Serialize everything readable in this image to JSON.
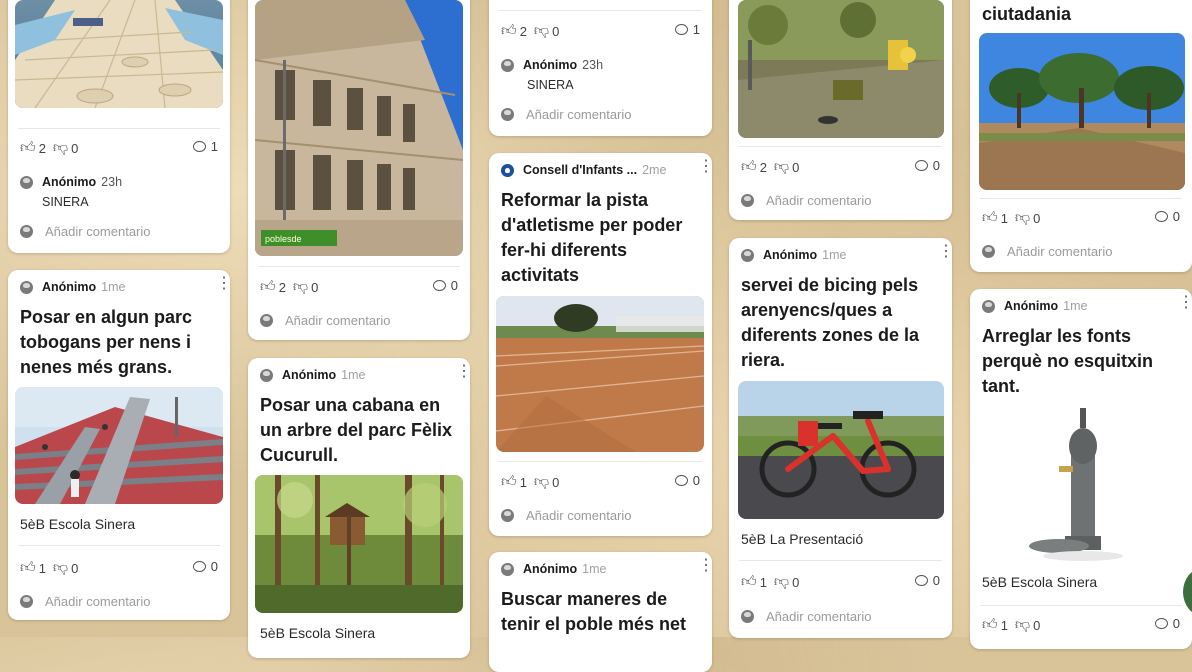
{
  "colors": {
    "board_bg": "#d9c49a",
    "card_bg": "#ffffff",
    "muted": "#9b9b9b"
  },
  "icons": {
    "like": "thumbs-up-icon",
    "dislike": "thumbs-down-icon",
    "comment": "comment-icon",
    "menu": "more-vertical-icon"
  },
  "add_comment": "Añadir comentario",
  "cards": {
    "c1a": {
      "likes": "2",
      "dislikes": "0",
      "comments": "1",
      "author": "Anónimo",
      "time": "23h",
      "comment_text": "SINERA"
    },
    "c1b": {
      "author": "Anónimo",
      "time": "1me",
      "title_lines": [
        "Posar en algun parc",
        "tobogans per nens i",
        "nenes més grans."
      ],
      "caption": "5èB Escola Sinera",
      "likes": "1",
      "dislikes": "0",
      "comments": "0"
    },
    "c2a": {
      "watermark": "poblesde",
      "likes": "2",
      "dislikes": "0",
      "comments": "0"
    },
    "c2b": {
      "author": "Anónimo",
      "time": "1me",
      "title_lines": [
        "Posar una cabana en",
        "un arbre del parc Fèlix",
        "Cucurull."
      ],
      "caption": "5èB Escola Sinera"
    },
    "c3a": {
      "likes": "2",
      "dislikes": "0",
      "comments": "1",
      "author": "Anónimo",
      "time": "23h",
      "comment_text": "SINERA"
    },
    "c3b": {
      "author": "Consell d'Infants ...",
      "time": "2me",
      "title_lines": [
        "Reformar la pista",
        "d'atletisme per poder",
        "fer-hi diferents",
        "activitats"
      ],
      "likes": "1",
      "dislikes": "0",
      "comments": "0"
    },
    "c3c": {
      "author": "Anónimo",
      "time": "1me",
      "title_lines": [
        "Buscar maneres de",
        "tenir el poble més net"
      ]
    },
    "c4a": {
      "likes": "2",
      "dislikes": "0",
      "comments": "0"
    },
    "c4b": {
      "author": "Anónimo",
      "time": "1me",
      "title_lines": [
        "servei de bicing pels",
        "arenyencs/ques a",
        "diferents zones de la",
        "riera."
      ],
      "caption": "5èB La Presentació",
      "likes": "1",
      "dislikes": "0",
      "comments": "0"
    },
    "c5a": {
      "title_lines": [
        "ciutadania"
      ],
      "likes": "1",
      "dislikes": "0",
      "comments": "0"
    },
    "c5b": {
      "author": "Anónimo",
      "time": "1me",
      "title_lines": [
        "Arreglar les fonts",
        "perquè no esquitxin",
        "tant."
      ],
      "caption": "5èB Escola Sinera",
      "likes": "1",
      "dislikes": "0",
      "comments": "0"
    }
  }
}
